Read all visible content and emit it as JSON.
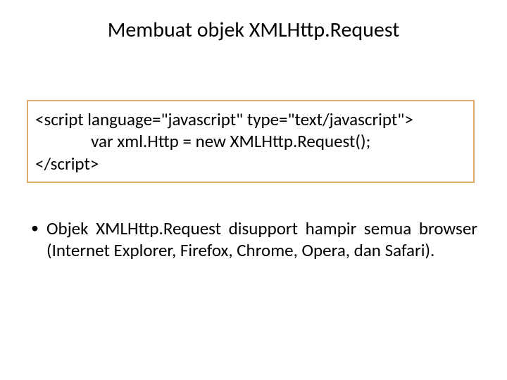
{
  "title": "Membuat objek XMLHttp.Request",
  "code": {
    "line1": "<script language=\"javascript\" type=\"text/javascript\">",
    "line2": "              var xml.Http = new XMLHttp.Request();",
    "line3": "</script>"
  },
  "bullet": {
    "marker": "•",
    "text": "Objek XMLHttp.Request disupport hampir semua browser (Internet Explorer, Firefox, Chrome, Opera, dan Safari)."
  }
}
